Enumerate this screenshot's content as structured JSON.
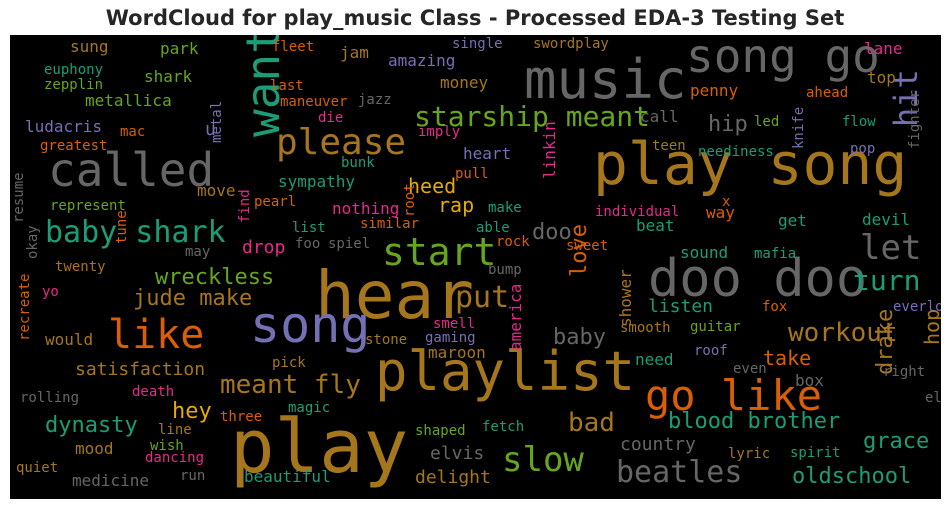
{
  "title": "WordCloud for play_music Class - Processed EDA-3 Testing Set",
  "words": [
    "play",
    "hear",
    "play song",
    "playlist",
    "song",
    "music",
    "doo doo",
    "song go",
    "called",
    "go like",
    "want",
    "please",
    "like",
    "baby shark",
    "start",
    "slow",
    "beatles",
    "starship meant",
    "meant fly",
    "let",
    "turn",
    "workout",
    "jude make",
    "put",
    "wreckless",
    "hit",
    "blood brother",
    "bad",
    "hey",
    "grace",
    "oldschool",
    "dynasty",
    "love",
    "take",
    "baby",
    "drake",
    "hop",
    "hip",
    "doo",
    "heed",
    "rap",
    "drop",
    "delight",
    "country",
    "elvis",
    "listen",
    "satisfaction",
    "maroon",
    "sympathy",
    "nothing",
    "beat",
    "sound",
    "devil",
    "get",
    "way",
    "move",
    "medicine",
    "mood",
    "beautiful",
    "metallica",
    "ludacris",
    "amazing",
    "money",
    "penny",
    "heart",
    "call",
    "shark",
    "sung",
    "park",
    "jam",
    "lane",
    "top",
    "u",
    "linkin",
    "america",
    "shower",
    "need",
    "box",
    "would",
    "yo",
    "fetch",
    "shaped",
    "lyric",
    "spirit",
    "smooth",
    "guitar",
    "fox",
    "everlong",
    "stone",
    "gaming",
    "smell",
    "wish",
    "dancing",
    "line",
    "magic",
    "three",
    "run",
    "quiet",
    "rolling",
    "death",
    "pick",
    "roof",
    "even",
    "right",
    "else",
    "recreate",
    "twenty",
    "tune",
    "may",
    "okay",
    "resume",
    "represent",
    "greatest",
    "mac",
    "euphony",
    "zepplin",
    "fleet",
    "last",
    "maneuver",
    "die",
    "jazz",
    "metal",
    "imply",
    "single",
    "swordplay",
    "ahead",
    "knife",
    "led",
    "flow",
    "fighter",
    "pop",
    "neediness",
    "teen",
    "bunk",
    "pull",
    "find",
    "pearl",
    "root",
    "make",
    "individual",
    "x",
    "list",
    "foo",
    "spiel",
    "similar",
    "able",
    "rock",
    "sweet",
    "bump",
    "mafia"
  ],
  "colors": {
    "brown": "#a6761d",
    "gray": "#666666",
    "orange": "#d95f02",
    "green": "#66a61e",
    "teal": "#1b9e77",
    "purple": "#7570b3",
    "pink": "#e7298a",
    "yellow": "#e6ab02"
  }
}
